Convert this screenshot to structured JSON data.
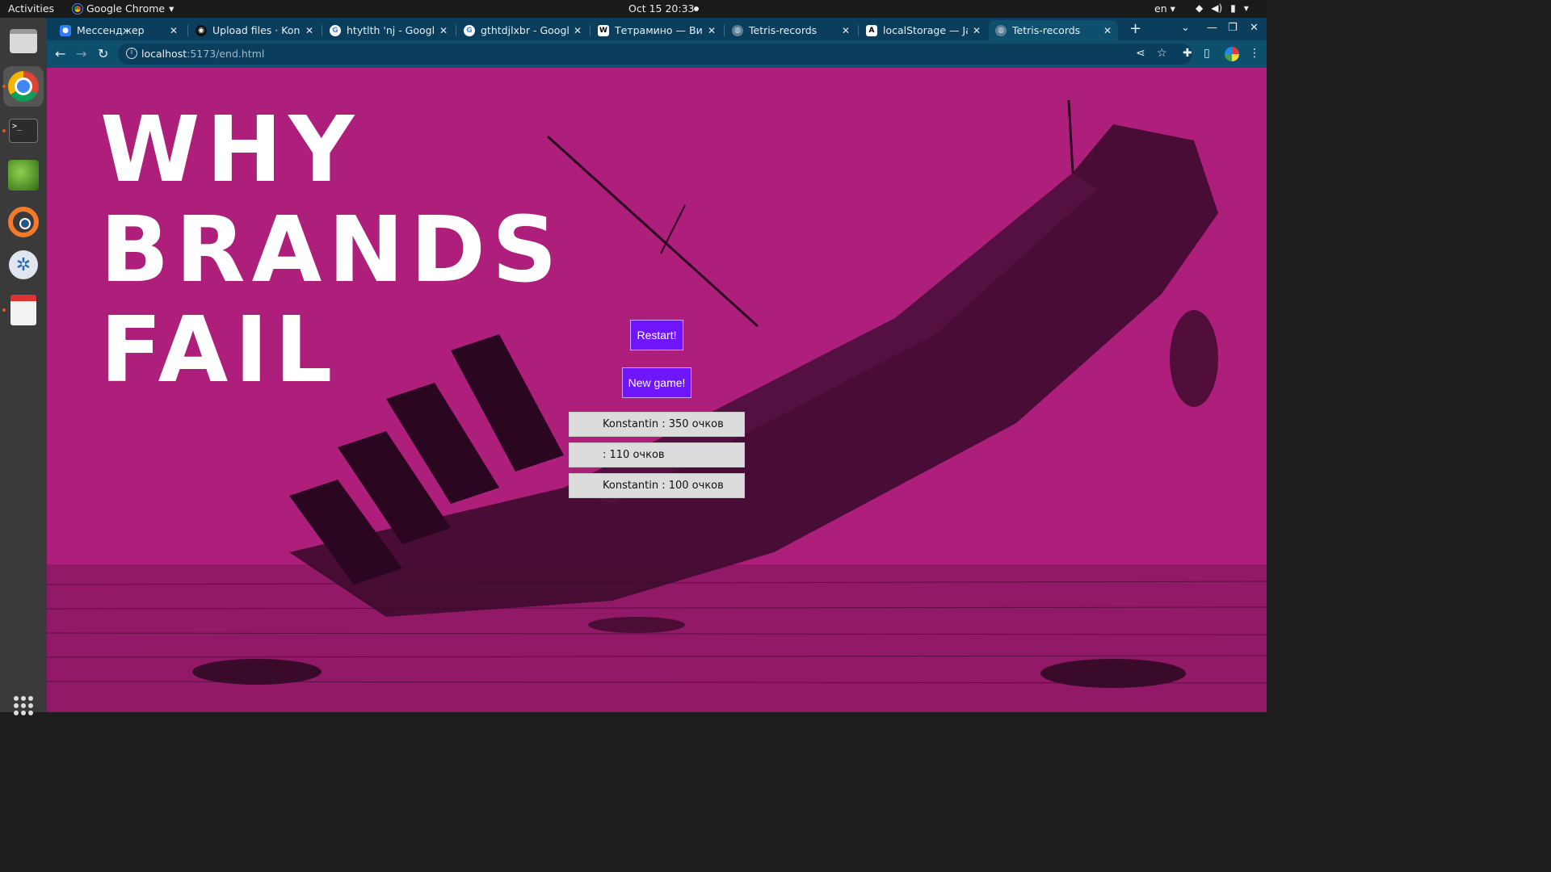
{
  "system_bar": {
    "activities": "Activities",
    "app_name": "Google Chrome",
    "clock": "Oct 15  20:33",
    "language": "en"
  },
  "dock": {
    "apps": [
      "files",
      "chrome",
      "terminal",
      "image-viewer",
      "blender",
      "vscodium",
      "document-viewer"
    ]
  },
  "browser": {
    "tabs": [
      {
        "title": "Мессенджер",
        "favicon": "messenger-icon",
        "active": false
      },
      {
        "title": "Upload files · Konst",
        "favicon": "github-icon",
        "active": false
      },
      {
        "title": "htytlth 'nj - Google S",
        "favicon": "google-icon",
        "active": false
      },
      {
        "title": "gthtdjlxbr - Google",
        "favicon": "google-icon",
        "active": false
      },
      {
        "title": "Тетрамино — Вики",
        "favicon": "wikipedia-icon",
        "active": false
      },
      {
        "title": "Tetris-records",
        "favicon": "globe-icon",
        "active": false
      },
      {
        "title": "localStorage — Jav",
        "favicon": "mdn-icon",
        "active": false
      },
      {
        "title": "Tetris-records",
        "favicon": "globe-icon",
        "active": true
      }
    ],
    "url_host": "localhost",
    "url_rest": ":5173/end.html"
  },
  "page": {
    "background_color": "#ad1f7a",
    "headline_lines": [
      "WHY",
      "BRANDS",
      "FAIL"
    ],
    "restart_label": "Restart!",
    "new_game_label": "New game!",
    "button_color": "#6f15ff",
    "records": [
      "Konstantin : 350 очков",
      " : 110 очков",
      "Konstantin : 100 очков"
    ]
  }
}
